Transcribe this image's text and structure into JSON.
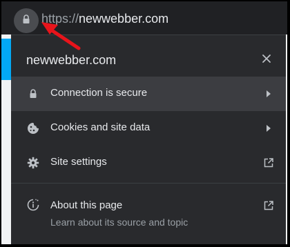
{
  "address_bar": {
    "url_scheme": "https://",
    "url_host": "newwebber.com",
    "site_info_icon": "lock-icon"
  },
  "site_info": {
    "title": "newwebber.com",
    "close_icon": "close-icon",
    "items": [
      {
        "label": "Connection is secure",
        "icon": "lock-icon",
        "trailing_icon": "chevron-right-icon",
        "selected": true
      },
      {
        "label": "Cookies and site data",
        "icon": "cookie-icon",
        "trailing_icon": "chevron-right-icon",
        "selected": false
      },
      {
        "label": "Site settings",
        "icon": "gear-icon",
        "trailing_icon": "external-link-icon",
        "selected": false
      }
    ],
    "about": {
      "label": "About this page",
      "subtitle": "Learn about its source and topic",
      "icon": "about-page-icon",
      "trailing_icon": "external-link-icon"
    }
  },
  "annotation": {
    "arrow_color": "#e8141b",
    "arrow_icon": "red-arrow-annotation"
  },
  "colors": {
    "popup_bg": "#292a2d",
    "selected_row_bg": "#3c3d41",
    "text_primary": "#e8eaed",
    "text_secondary": "#9aa0a6",
    "page_accent": "#03a9f4"
  }
}
